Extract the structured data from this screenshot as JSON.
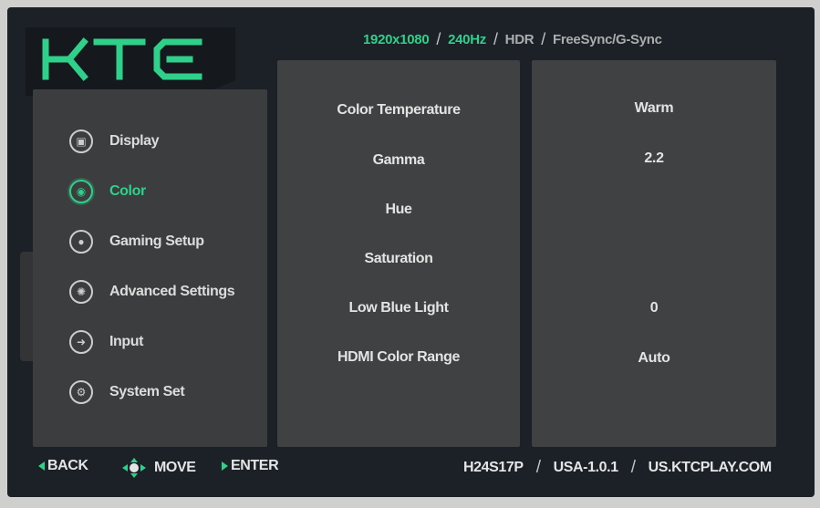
{
  "brand": {
    "logo_text": "KTC",
    "accent_color": "#2fd18a"
  },
  "status": {
    "resolution": "1920x1080",
    "refresh": "240Hz",
    "hdr": "HDR",
    "sync": "FreeSync/G-Sync",
    "active_color": "#2fd18a",
    "inactive_color": "#a9aeac"
  },
  "nav": {
    "items": [
      {
        "label": "Display",
        "icon": "display-icon",
        "active": false
      },
      {
        "label": "Color",
        "icon": "color-icon",
        "active": true
      },
      {
        "label": "Gaming Setup",
        "icon": "gaming-icon",
        "active": false
      },
      {
        "label": "Advanced Settings",
        "icon": "advanced-settings-icon",
        "active": false
      },
      {
        "label": "Input",
        "icon": "input-icon",
        "active": false
      },
      {
        "label": "System Set",
        "icon": "system-set-icon",
        "active": false
      }
    ]
  },
  "options": [
    {
      "label": "Color Temperature",
      "value": "Warm"
    },
    {
      "label": "Gamma",
      "value": "2.2"
    },
    {
      "label": "Hue",
      "value": ""
    },
    {
      "label": "Saturation",
      "value": ""
    },
    {
      "label": "Low Blue Light",
      "value": "0"
    },
    {
      "label": "HDMI Color Range",
      "value": "Auto"
    }
  ],
  "footer": {
    "back": "BACK",
    "move": "MOVE",
    "enter": "ENTER",
    "model": "H24S17P",
    "firmware": "USA-1.0.1",
    "website": "US.KTCPLAY.COM"
  }
}
